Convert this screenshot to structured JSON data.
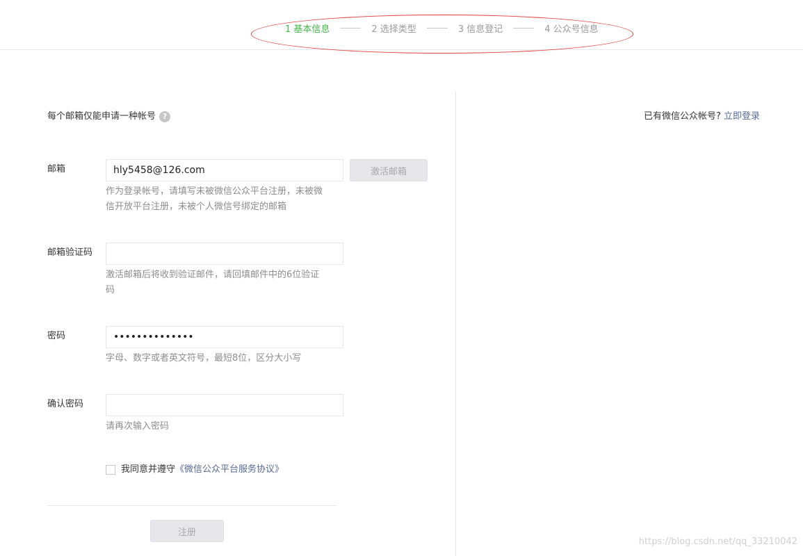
{
  "steps": [
    {
      "label": "1 基本信息",
      "active": true
    },
    {
      "label": "2 选择类型",
      "active": false
    },
    {
      "label": "3 信息登记",
      "active": false
    },
    {
      "label": "4 公众号信息",
      "active": false
    }
  ],
  "tip": {
    "text": "每个邮箱仅能申请一种帐号",
    "icon": "question-icon"
  },
  "login": {
    "prompt": "已有微信公众帐号?",
    "link": "立即登录"
  },
  "form": {
    "email": {
      "label": "邮箱",
      "value": "hly5458@126.com",
      "button": "激活邮箱",
      "hint": "作为登录帐号，请填写未被微信公众平台注册，未被微信开放平台注册，未被个人微信号绑定的邮箱"
    },
    "code": {
      "label": "邮箱验证码",
      "value": "",
      "hint": "激活邮箱后将收到验证邮件，请回填邮件中的6位验证码"
    },
    "password": {
      "label": "密码",
      "value": "••••••••••••••",
      "hint": "字母、数字或者英文符号，最短8位，区分大小写"
    },
    "confirm": {
      "label": "确认密码",
      "value": "",
      "hint": "请再次输入密码"
    },
    "agreement": {
      "text": "我同意并遵守",
      "link": "《微信公众平台服务协议》",
      "checked": false
    },
    "submit": "注册"
  },
  "watermark": "https://blog.csdn.net/qq_33210042",
  "colors": {
    "active_step": "#44b549",
    "link": "#576b95",
    "annotation_oval": "#e03c3c"
  }
}
